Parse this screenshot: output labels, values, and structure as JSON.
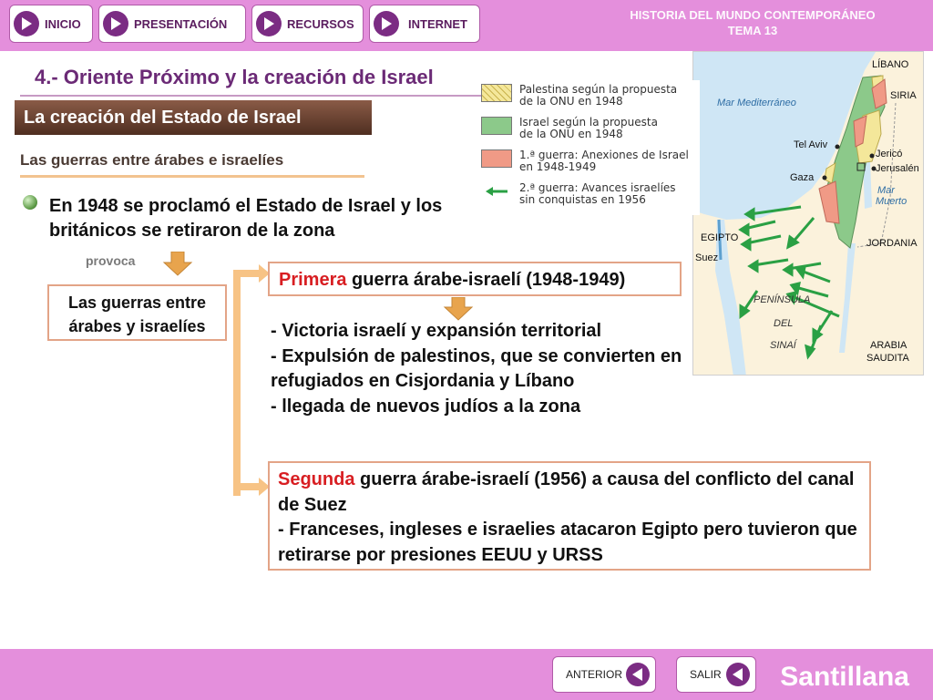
{
  "nav": {
    "inicio": "INICIO",
    "presentacion": "PRESENTACIÓN",
    "recursos": "RECURSOS",
    "internet": "INTERNET"
  },
  "course": {
    "title_line1": "HISTORIA DEL MUNDO CONTEMPORÁNEO",
    "title_line2": "TEMA 13"
  },
  "section_title": "4.- Oriente Próximo y la creación de Israel",
  "banner": "La creación del Estado de Israel",
  "subheading": "Las guerras entre árabes e israelíes",
  "bullet_text": "En 1948 se proclamó el Estado de Israel y los británicos se retiraron de la zona",
  "provoca": "provoca",
  "wars_box": {
    "line1": "Las guerras entre",
    "line2": "árabes y israelíes"
  },
  "first_war": {
    "prefix": "Primera",
    "rest": " guerra árabe-israelí (1948-1949)",
    "points": [
      "- Victoria israelí y expansión territorial",
      "- Expulsión de palestinos, que se convierten en refugiados en Cisjordania y Líbano",
      "- llegada de nuevos judíos a la zona"
    ]
  },
  "second_war": {
    "prefix": "Segunda",
    "rest": " guerra árabe-israelí (1956)   a causa del conflicto del canal de Suez",
    "point": "- Franceses, ingleses e israelies atacaron Egipto pero tuvieron que retirarse por presiones EEUU y URSS"
  },
  "map": {
    "legend": [
      {
        "text": "Palestina según la propuesta\nde la ONU en 1948",
        "color": "#f4e79a"
      },
      {
        "text": "Israel según la propuesta\nde la ONU en 1948",
        "color": "#8cc98a"
      },
      {
        "text": "1.ª guerra: Anexiones de Israel\nen 1948-1949",
        "color": "#f09a86"
      },
      {
        "text": "2.ª guerra: Avances israelíes\nsin conquistas en 1956",
        "color": "#2aa044"
      }
    ],
    "labels": {
      "libano": "LÍBANO",
      "siria": "SIRIA",
      "mar_med": "Mar Mediterráneo",
      "tel_aviv": "Tel Aviv",
      "jerico": "Jericó",
      "jerusalen": "Jerusalén",
      "gaza": "Gaza",
      "mar_muerto_1": "Mar",
      "mar_muerto_2": "Muerto",
      "egipto": "EGIPTO",
      "jordania": "JORDANIA",
      "suez": "Suez",
      "peninsula": "PENÍNSULA",
      "del": "DEL",
      "sinai": "SINAÍ",
      "arabia_1": "ARABIA",
      "arabia_2": "SAUDITA"
    }
  },
  "footer": {
    "anterior": "ANTERIOR",
    "salir": "SALIR",
    "brand": "Santillana"
  },
  "colors": {
    "topbar": "#e48fdc",
    "accent_purple": "#7b2c83",
    "heading": "#6b2a76",
    "war_label_red": "#d81e22",
    "bracket": "#f7c385",
    "box_border": "#e3a487"
  }
}
